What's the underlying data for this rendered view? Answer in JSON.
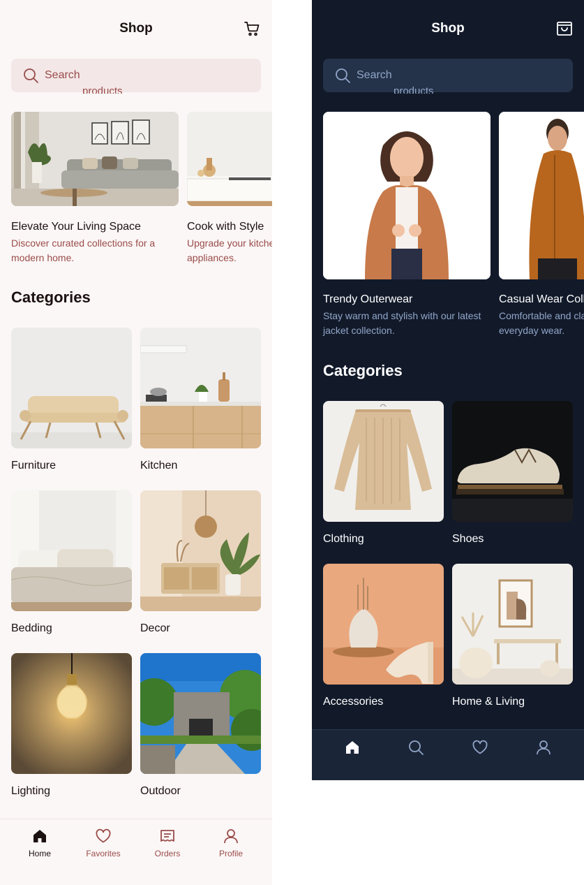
{
  "light": {
    "title": "Shop",
    "search": {
      "placeholder": "Search",
      "ghost_text": "products"
    },
    "featured": [
      {
        "title": "Elevate Your Living Space",
        "description": "Discover curated collections for a modern home."
      },
      {
        "title": "Cook with Style",
        "description": "Upgrade your kitchen with modern appliances."
      }
    ],
    "categories_heading": "Categories",
    "categories": [
      {
        "label": "Furniture"
      },
      {
        "label": "Kitchen"
      },
      {
        "label": "Bedding"
      },
      {
        "label": "Decor"
      },
      {
        "label": "Lighting"
      },
      {
        "label": "Outdoor"
      }
    ],
    "nav": [
      {
        "label": "Home",
        "icon": "home-icon",
        "active": true
      },
      {
        "label": "Favorites",
        "icon": "heart-icon",
        "active": false
      },
      {
        "label": "Orders",
        "icon": "orders-icon",
        "active": false
      },
      {
        "label": "Profile",
        "icon": "user-icon",
        "active": false
      }
    ],
    "colors": {
      "background": "#fbf7f6",
      "accent": "#994c4a",
      "search_bg": "#f3e7e7",
      "text": "#1b1110"
    }
  },
  "dark": {
    "title": "Shop",
    "search": {
      "placeholder": "Search",
      "ghost_text": "products"
    },
    "featured": [
      {
        "title": "Trendy Outerwear",
        "description": "Stay warm and stylish with our latest jacket collection."
      },
      {
        "title": "Casual Wear Collection",
        "description": "Comfortable and classic styles for everyday wear."
      }
    ],
    "categories_heading": "Categories",
    "categories": [
      {
        "label": "Clothing"
      },
      {
        "label": "Shoes"
      },
      {
        "label": "Accessories"
      },
      {
        "label": "Home & Living"
      }
    ],
    "nav": [
      {
        "icon": "home-icon",
        "active": true
      },
      {
        "icon": "search-icon",
        "active": false
      },
      {
        "icon": "heart-icon",
        "active": false
      },
      {
        "icon": "user-icon",
        "active": false
      }
    ],
    "colors": {
      "background": "#121a2a",
      "accent": "#91a5c8",
      "search_bg": "#243349",
      "text": "#ffffff"
    }
  }
}
